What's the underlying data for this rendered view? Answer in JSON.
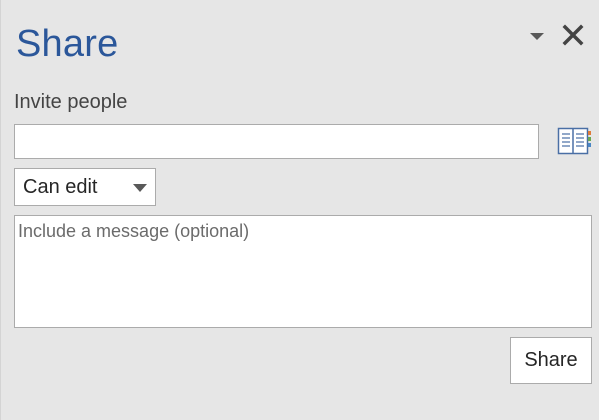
{
  "pane": {
    "title": "Share",
    "accent_color": "#2b579a",
    "background_color": "#e6e6e6",
    "options_icon": "chevron-down-icon",
    "close_icon": "close-icon"
  },
  "invite": {
    "label": "Invite people",
    "value": "",
    "address_book_icon": "address-book-icon"
  },
  "permission": {
    "selected": "Can edit",
    "chevron_icon": "chevron-down-icon"
  },
  "message": {
    "placeholder": "Include a message (optional)",
    "value": ""
  },
  "actions": {
    "share_label": "Share"
  }
}
